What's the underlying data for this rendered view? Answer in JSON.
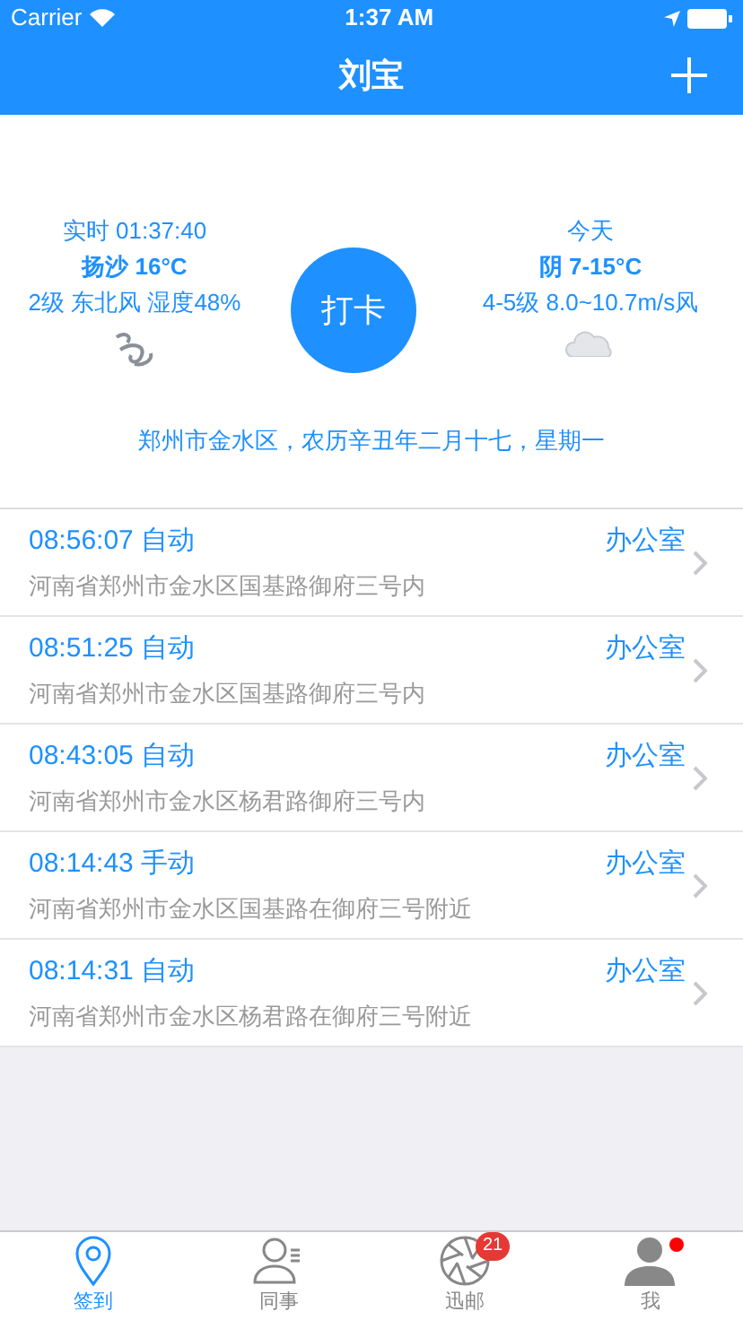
{
  "status_bar": {
    "carrier": "Carrier",
    "time": "1:37 AM"
  },
  "nav": {
    "title": "刘宝"
  },
  "weather_now": {
    "time": "实时 01:37:40",
    "condition": "扬沙  16°C",
    "wind": "2级 东北风 湿度48%"
  },
  "weather_today": {
    "label": "今天",
    "condition": "阴  7-15°C",
    "wind": "4-5级 8.0~10.7m/s风"
  },
  "punch_button": "打卡",
  "location_line": "郑州市金水区，农历辛丑年二月十七，星期一",
  "records": [
    {
      "time": "08:56:07 自动",
      "place": "办公室",
      "address": "河南省郑州市金水区国基路御府三号内"
    },
    {
      "time": "08:51:25 自动",
      "place": "办公室",
      "address": "河南省郑州市金水区国基路御府三号内"
    },
    {
      "time": "08:43:05 自动",
      "place": "办公室",
      "address": "河南省郑州市金水区杨君路御府三号内"
    },
    {
      "time": "08:14:43 手动",
      "place": "办公室",
      "address": "河南省郑州市金水区国基路在御府三号附近"
    },
    {
      "time": "08:14:31 自动",
      "place": "办公室",
      "address": "河南省郑州市金水区杨君路在御府三号附近"
    }
  ],
  "tabs": [
    {
      "kind": "pin",
      "label": "签到",
      "selected": true
    },
    {
      "kind": "contacts",
      "label": "同事",
      "selected": false
    },
    {
      "kind": "aperture",
      "label": "迅邮",
      "selected": false,
      "badge": "21"
    },
    {
      "kind": "person",
      "label": "我",
      "selected": false,
      "dot": true
    }
  ]
}
